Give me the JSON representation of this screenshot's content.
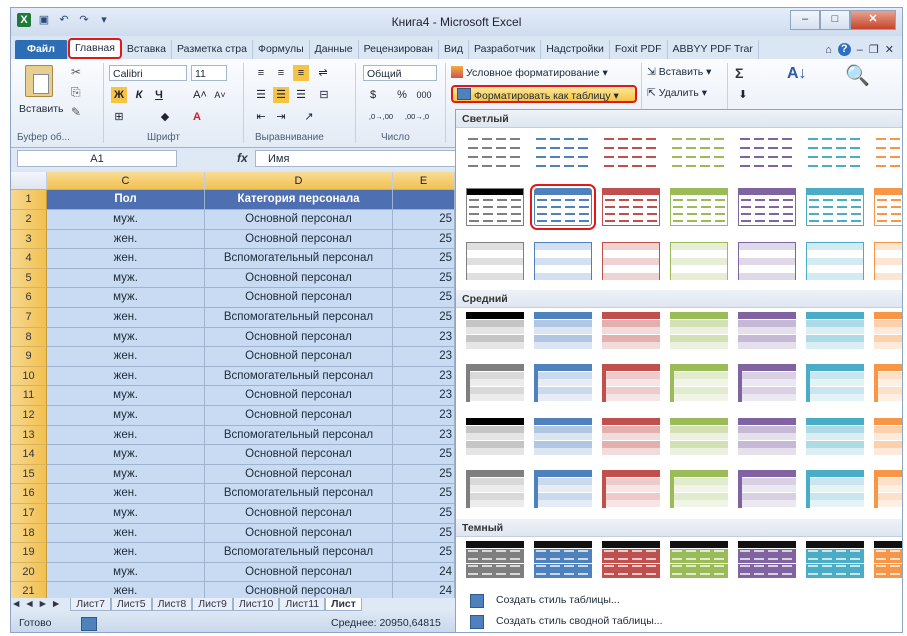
{
  "window": {
    "title": "Книга4 - Microsoft Excel",
    "buttons": {
      "min": "–",
      "max": "□",
      "close": "✕"
    }
  },
  "quick_access": [
    {
      "icon": "excel-icon",
      "glyph": "X"
    },
    {
      "icon": "save-icon",
      "glyph": "▣"
    },
    {
      "icon": "undo-icon",
      "glyph": "↶"
    },
    {
      "icon": "redo-icon",
      "glyph": "↷"
    },
    {
      "icon": "customize-icon",
      "glyph": "▾"
    }
  ],
  "tabs": [
    {
      "label": "Файл",
      "kind": "file"
    },
    {
      "label": "Главная",
      "kind": "active"
    },
    {
      "label": "Вставка"
    },
    {
      "label": "Разметка стра"
    },
    {
      "label": "Формулы"
    },
    {
      "label": "Данные"
    },
    {
      "label": "Рецензирован"
    },
    {
      "label": "Вид"
    },
    {
      "label": "Разработчик"
    },
    {
      "label": "Надстройки"
    },
    {
      "label": "Foxit PDF"
    },
    {
      "label": "ABBYY PDF Trar"
    }
  ],
  "ribbon": {
    "clipboard": {
      "paste": "Вставить",
      "label": "Буфер об..."
    },
    "font": {
      "name": "Calibri",
      "size": "11",
      "label": "Шрифт",
      "bold": "Ж",
      "italic": "К",
      "underline": "Ч",
      "grow": "A˄",
      "shrink": "A˅",
      "color_a": "A"
    },
    "alignment": {
      "label": "Выравнивание"
    },
    "number": {
      "format": "Общий",
      "label": "Число",
      "percent": "%",
      "thousands": "000",
      "inc": ",0→,00",
      "dec": ",00→,0"
    },
    "styles": {
      "conditional": "Условное форматирование",
      "format_table": "Форматировать как таблицу"
    },
    "cells": {
      "insert": "Вставить",
      "delete": "Удалить"
    },
    "editing": {
      "sigma": "Σ",
      "sort": "A↓",
      "find": "🔍"
    }
  },
  "formula_bar": {
    "cell_ref": "A1",
    "fx": "fx",
    "value": "Имя"
  },
  "columns": [
    "C",
    "D",
    "E"
  ],
  "table": {
    "header": {
      "row": "1",
      "c": "Пол",
      "d": "Категория персонала",
      "e": ""
    },
    "rows": [
      {
        "n": "2",
        "c": "муж.",
        "d": "Основной персонал",
        "e": "25"
      },
      {
        "n": "3",
        "c": "жен.",
        "d": "Основной персонал",
        "e": "25"
      },
      {
        "n": "4",
        "c": "жен.",
        "d": "Вспомогательный персонал",
        "e": "25"
      },
      {
        "n": "5",
        "c": "муж.",
        "d": "Основной персонал",
        "e": "25"
      },
      {
        "n": "6",
        "c": "муж.",
        "d": "Основной персонал",
        "e": "25"
      },
      {
        "n": "7",
        "c": "жен.",
        "d": "Вспомогательный персонал",
        "e": "25"
      },
      {
        "n": "8",
        "c": "муж.",
        "d": "Основной персонал",
        "e": "23"
      },
      {
        "n": "9",
        "c": "жен.",
        "d": "Основной персонал",
        "e": "23"
      },
      {
        "n": "10",
        "c": "жен.",
        "d": "Вспомогательный персонал",
        "e": "23"
      },
      {
        "n": "11",
        "c": "муж.",
        "d": "Основной персонал",
        "e": "23"
      },
      {
        "n": "12",
        "c": "муж.",
        "d": "Основной персонал",
        "e": "23"
      },
      {
        "n": "13",
        "c": "жен.",
        "d": "Вспомогательный персонал",
        "e": "23"
      },
      {
        "n": "14",
        "c": "муж.",
        "d": "Основной персонал",
        "e": "25"
      },
      {
        "n": "15",
        "c": "муж.",
        "d": "Основной персонал",
        "e": "25"
      },
      {
        "n": "16",
        "c": "жен.",
        "d": "Вспомогательный персонал",
        "e": "25"
      },
      {
        "n": "17",
        "c": "муж.",
        "d": "Основной персонал",
        "e": "25"
      },
      {
        "n": "18",
        "c": "жен.",
        "d": "Основной персонал",
        "e": "25"
      },
      {
        "n": "19",
        "c": "жен.",
        "d": "Вспомогательный персонал",
        "e": "25"
      },
      {
        "n": "20",
        "c": "муж.",
        "d": "Основной персонал",
        "e": "24"
      },
      {
        "n": "21",
        "c": "жен.",
        "d": "Основной персонал",
        "e": "24"
      }
    ]
  },
  "sheet_tabs": [
    "Лист7",
    "Лист5",
    "Лист8",
    "Лист9",
    "Лист10",
    "Лист11",
    "Лист"
  ],
  "sheet_nav": "◄ ◄ ► ►",
  "status": {
    "ready": "Готово",
    "average": "Среднее: 20950,64815"
  },
  "gallery": {
    "sections": {
      "light": "Светлый",
      "medium": "Средний",
      "dark": "Темный"
    },
    "palette": [
      "#7f7f7f",
      "#4f81bd",
      "#c0504d",
      "#9bbb59",
      "#8064a2",
      "#4bacc6",
      "#f79646"
    ],
    "footer": {
      "new_table_style": "Создать стиль таблицы...",
      "new_pivot_style": "Создать стиль сводной таблицы..."
    }
  }
}
